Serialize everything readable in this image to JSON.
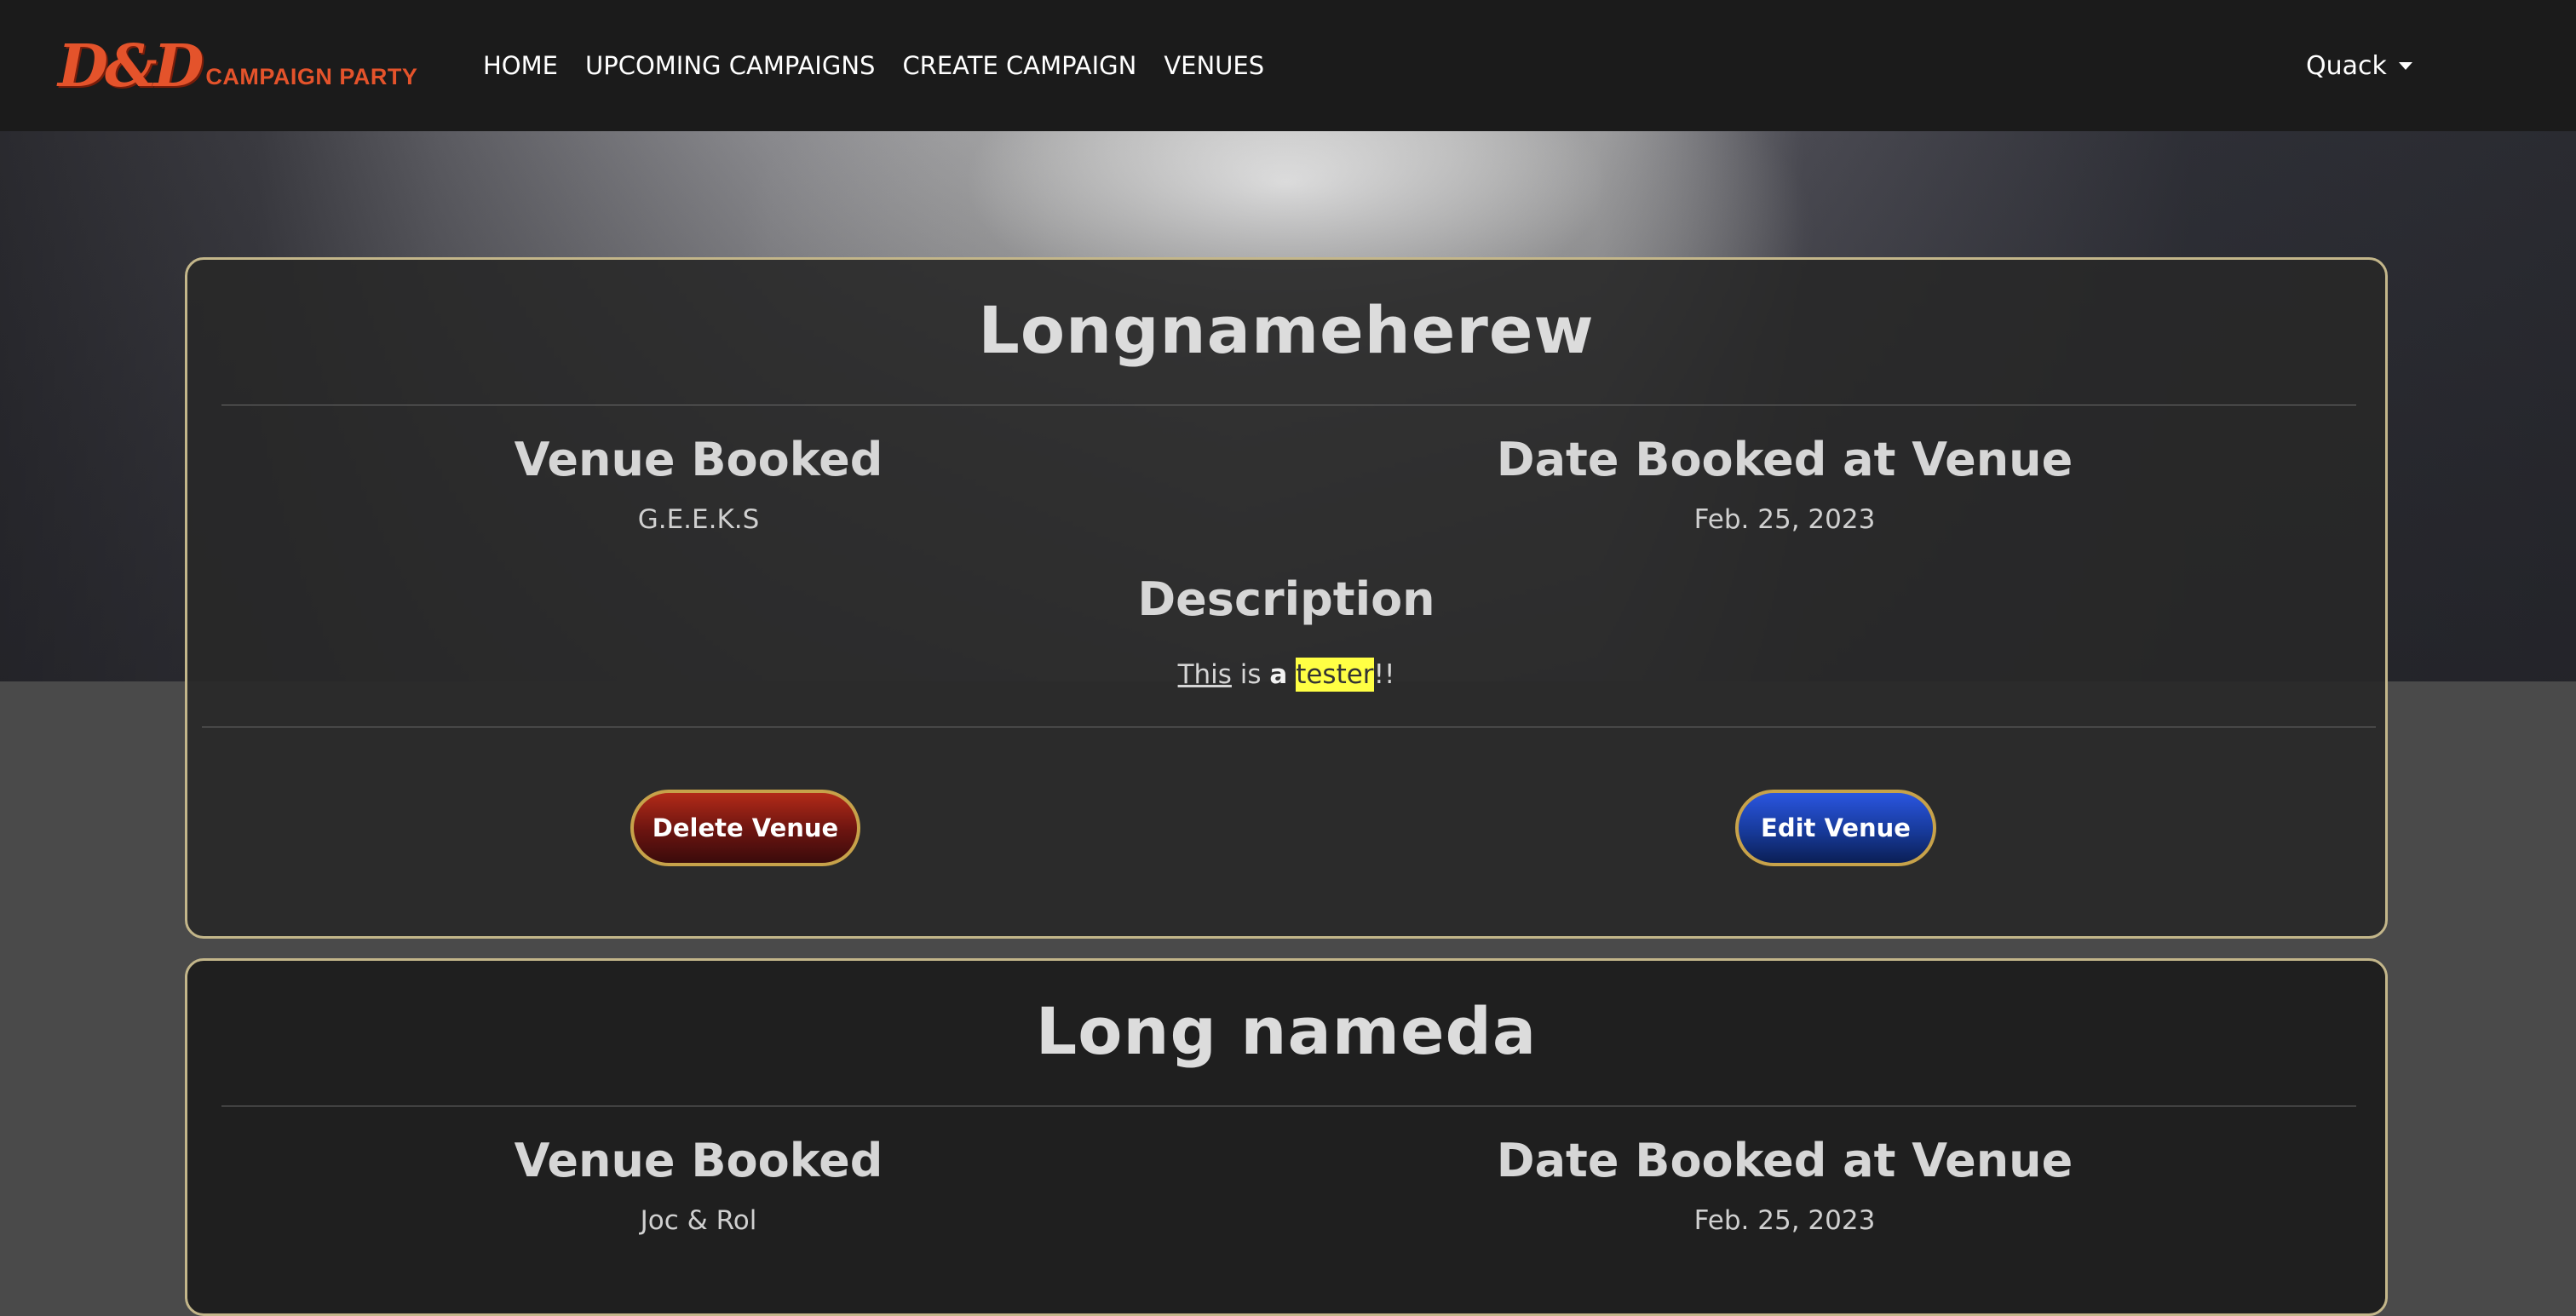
{
  "brand": {
    "logo_mark": "D&D",
    "logo_text": "CAMPAIGN PARTY"
  },
  "nav": {
    "items": [
      {
        "label": "HOME"
      },
      {
        "label": "UPCOMING CAMPAIGNS"
      },
      {
        "label": "CREATE CAMPAIGN"
      },
      {
        "label": "VENUES"
      }
    ],
    "user": "Quack"
  },
  "colors": {
    "accent": "#e4532b",
    "card_border": "#c3b68a",
    "delete_button": "#8b1c12",
    "edit_button": "#1e44b8",
    "highlight": "#ffff44"
  },
  "venues": [
    {
      "name": "Longnameherew",
      "venue_label": "Venue Booked",
      "venue_value": "G.E.E.K.S",
      "date_label": "Date Booked at Venue",
      "date_value": "Feb. 25, 2023",
      "description_label": "Description",
      "description": {
        "w1": "This",
        "w2": "is",
        "w3": "a",
        "w4": "tester",
        "w5": "!!"
      },
      "delete_label": "Delete Venue",
      "edit_label": "Edit Venue"
    },
    {
      "name": "Long nameda",
      "venue_label": "Venue Booked",
      "venue_value": "Joc & Rol",
      "date_label": "Date Booked at Venue",
      "date_value": "Feb. 25, 2023"
    }
  ]
}
